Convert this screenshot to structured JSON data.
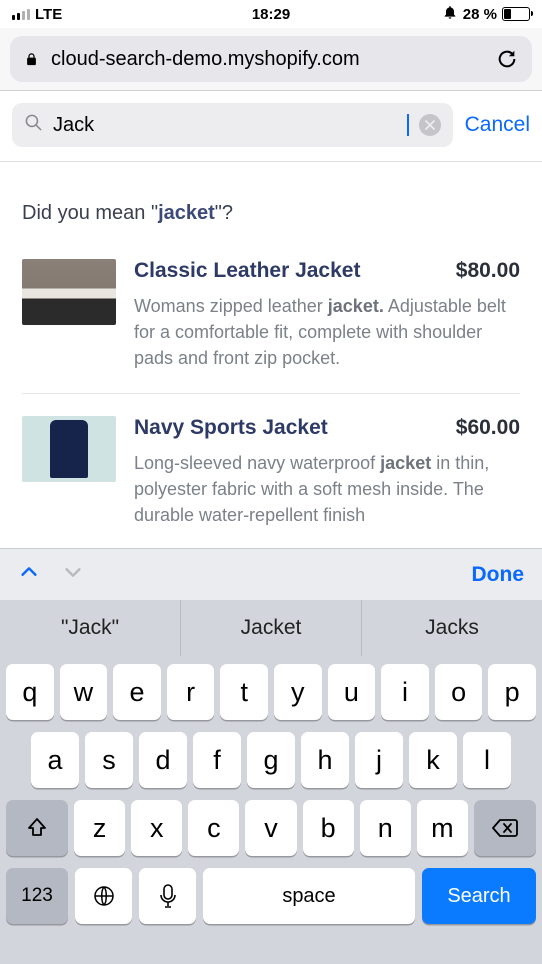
{
  "status": {
    "carrier": "LTE",
    "time": "18:29",
    "battery_pct": "28 %"
  },
  "browser": {
    "url": "cloud-search-demo.myshopify.com"
  },
  "search": {
    "value": "Jack",
    "cancel": "Cancel"
  },
  "dym": {
    "prefix": "Did you mean \"",
    "term": "jacket",
    "suffix": "\"?"
  },
  "results": [
    {
      "title": "Classic Leather Jacket",
      "price": "$80.00",
      "desc_before": "Womans zipped leather ",
      "desc_bold": "jacket.",
      "desc_after": " Adjustable belt for a comfortable fit, complete with shoulder pads and front zip pocket.",
      "thumb": "leather"
    },
    {
      "title": "Navy Sports Jacket",
      "price": "$60.00",
      "desc_before": "Long-sleeved navy waterproof ",
      "desc_bold": "jacket",
      "desc_after": " in thin, polyester fabric with a soft mesh inside. The durable water-repellent finish",
      "thumb": "navy"
    }
  ],
  "accessory": {
    "done": "Done"
  },
  "suggestions": [
    "\"Jack\"",
    "Jacket",
    "Jacks"
  ],
  "keyboard": {
    "row1": [
      "q",
      "w",
      "e",
      "r",
      "t",
      "y",
      "u",
      "i",
      "o",
      "p"
    ],
    "row2": [
      "a",
      "s",
      "d",
      "f",
      "g",
      "h",
      "j",
      "k",
      "l"
    ],
    "row3": [
      "z",
      "x",
      "c",
      "v",
      "b",
      "n",
      "m"
    ],
    "k123": "123",
    "space": "space",
    "search": "Search"
  }
}
